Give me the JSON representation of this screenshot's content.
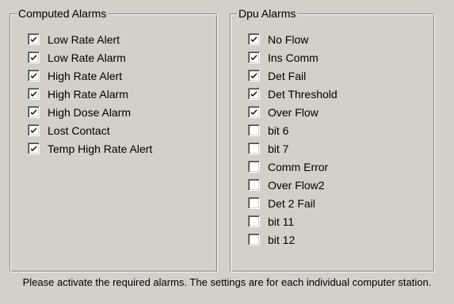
{
  "computed_alarms": {
    "title": "Computed Alarms",
    "items": [
      {
        "label": "Low Rate Alert",
        "checked": true
      },
      {
        "label": "Low Rate Alarm",
        "checked": true
      },
      {
        "label": "High Rate Alert",
        "checked": true
      },
      {
        "label": "High Rate Alarm",
        "checked": true
      },
      {
        "label": "High Dose Alarm",
        "checked": true
      },
      {
        "label": "Lost Contact",
        "checked": true
      },
      {
        "label": "Temp High Rate Alert",
        "checked": true
      }
    ]
  },
  "dpu_alarms": {
    "title": "Dpu Alarms",
    "items": [
      {
        "label": "No Flow",
        "checked": true
      },
      {
        "label": "Ins Comm",
        "checked": true
      },
      {
        "label": "Det Fail",
        "checked": true
      },
      {
        "label": "Det Threshold",
        "checked": true
      },
      {
        "label": "Over Flow",
        "checked": true
      },
      {
        "label": "bit 6",
        "checked": false
      },
      {
        "label": "bit 7",
        "checked": false
      },
      {
        "label": "Comm Error",
        "checked": false
      },
      {
        "label": "Over Flow2",
        "checked": false
      },
      {
        "label": "Det 2 Fail",
        "checked": false
      },
      {
        "label": "bit 11",
        "checked": false
      },
      {
        "label": "bit 12",
        "checked": false
      }
    ]
  },
  "footer": {
    "text": "Please activate the required alarms. The settings are for each individual computer station."
  },
  "icons": {
    "checkmark": "checkmark-icon"
  }
}
